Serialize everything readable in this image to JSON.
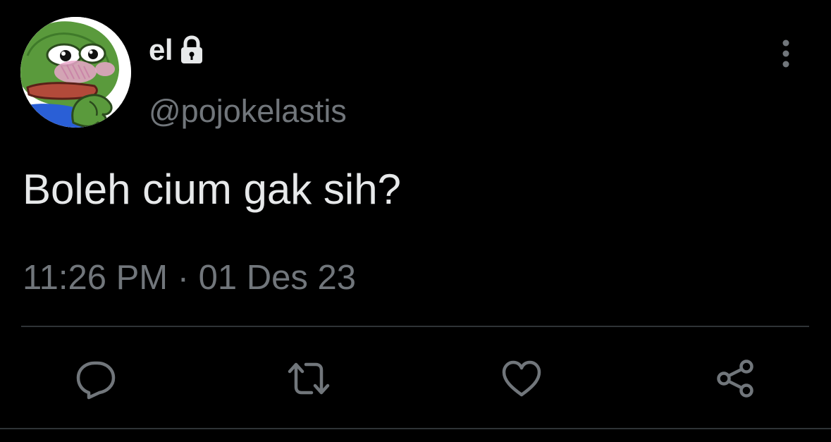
{
  "tweet": {
    "display_name": "el",
    "handle": "@pojokelastis",
    "text": "Boleh cium gak sih?",
    "timestamp": "11:26 PM · 01 Des 23",
    "protected": true
  },
  "icons": {
    "avatar": "pepe-frog-avatar",
    "lock": "lock-icon",
    "more": "more-vertical-icon",
    "reply": "reply-icon",
    "retweet": "retweet-icon",
    "like": "heart-icon",
    "share": "share-icon"
  },
  "colors": {
    "background": "#000000",
    "primary_text": "#e7e9ea",
    "secondary_text": "#71767b",
    "divider": "#2f3336",
    "icon": "#71767b"
  }
}
